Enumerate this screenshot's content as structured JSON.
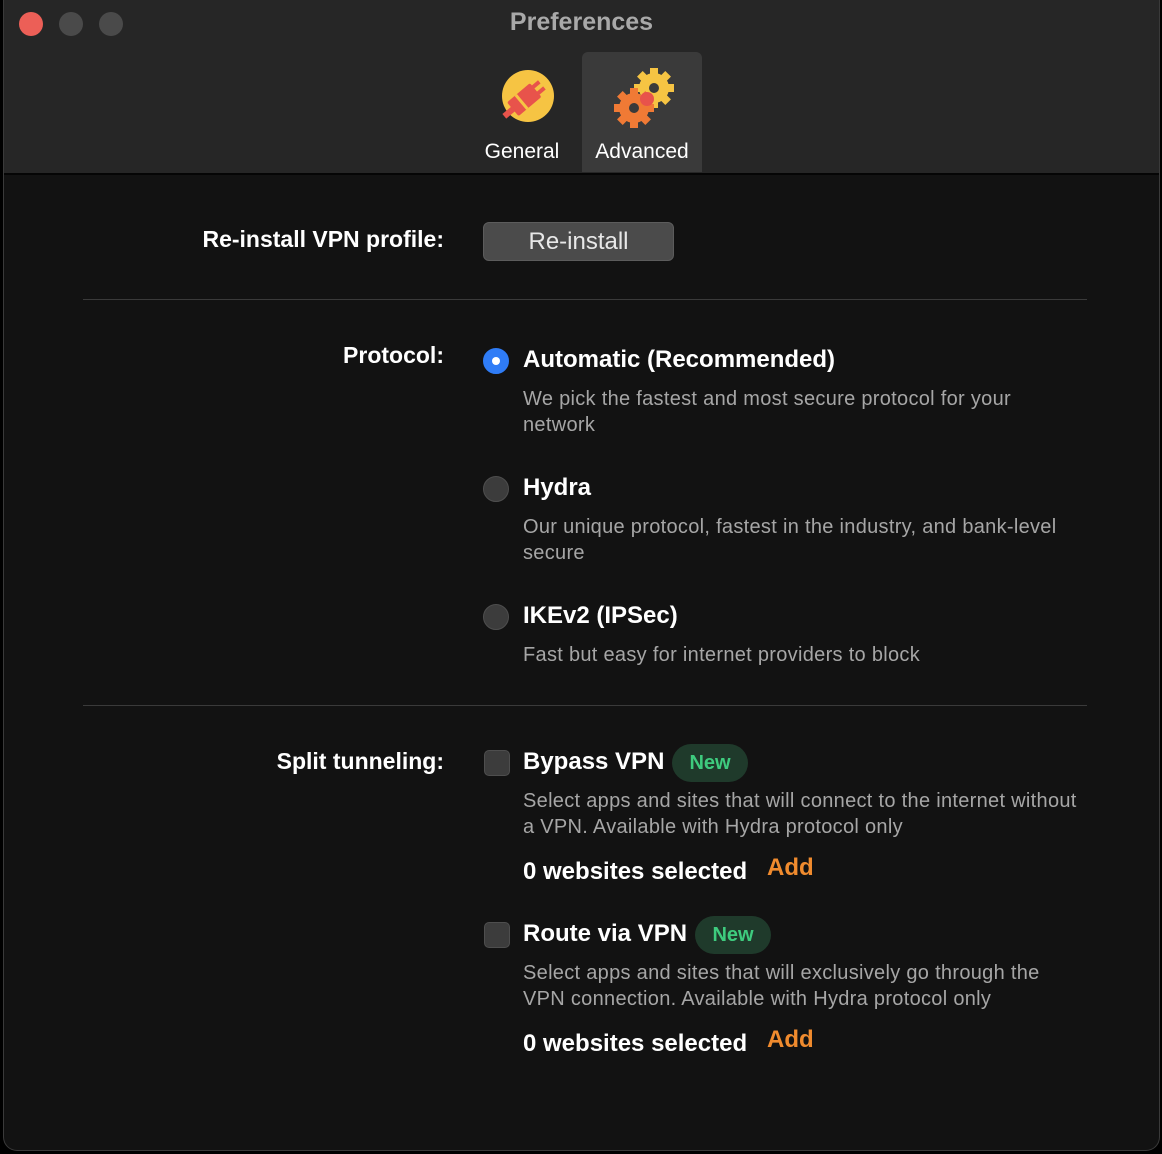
{
  "window": {
    "title": "Preferences",
    "tabs": [
      {
        "label": "General",
        "icon": "plug-icon",
        "selected": false
      },
      {
        "label": "Advanced",
        "icon": "gears-icon",
        "selected": true
      }
    ]
  },
  "reinstall": {
    "label": "Re-install VPN profile:",
    "button": "Re-install"
  },
  "protocol": {
    "label": "Protocol:",
    "options": [
      {
        "title": "Automatic (Recommended)",
        "description": "We pick the fastest and most secure protocol for your network",
        "selected": true
      },
      {
        "title": "Hydra",
        "description": "Our unique protocol, fastest in the industry, and bank-level secure",
        "selected": false
      },
      {
        "title": "IKEv2 (IPSec)",
        "description": "Fast but easy for internet providers to block",
        "selected": false
      }
    ]
  },
  "split_tunneling": {
    "label": "Split tunneling:",
    "options": [
      {
        "title": "Bypass VPN",
        "badge": "New",
        "description": "Select apps and sites that will connect to the internet without a VPN. Available with Hydra protocol only",
        "count": "0 websites selected",
        "action": "Add",
        "checked": false
      },
      {
        "title": "Route via VPN",
        "badge": "New",
        "description": "Select apps and sites that will exclusively go through the VPN connection. Available with Hydra protocol only",
        "count": "0 websites selected",
        "action": "Add",
        "checked": false
      }
    ]
  },
  "colors": {
    "accent": "#2f7cf6",
    "link": "#f08b2e",
    "badge_text": "#3ecb7e",
    "badge_bg": "#1f3a2b"
  }
}
